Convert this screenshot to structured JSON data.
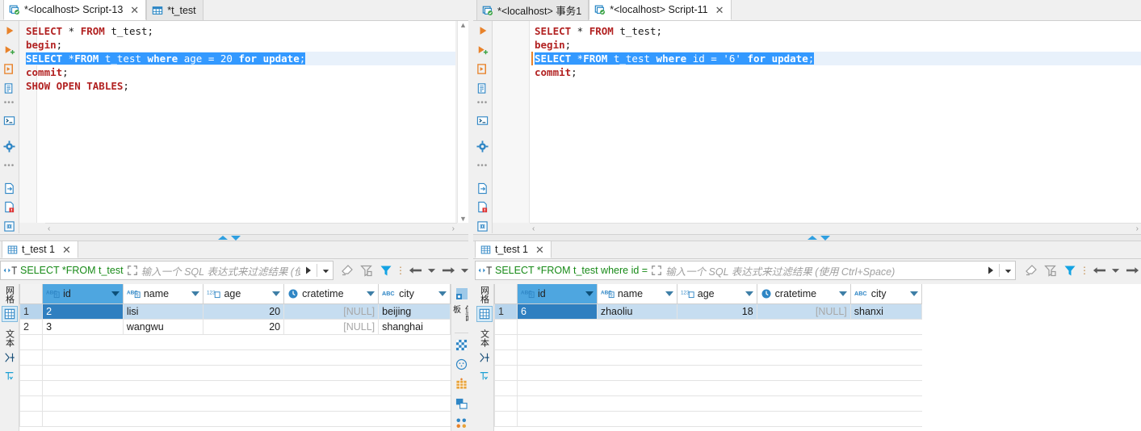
{
  "left_panel": {
    "editor_tabs": [
      {
        "label": "*<localhost> Script-13",
        "icon": "script-console-icon",
        "active": true,
        "closable": true
      },
      {
        "label": "*t_test",
        "icon": "table-icon",
        "active": false,
        "closable": false
      }
    ],
    "code_lines": [
      {
        "segments": [
          {
            "t": "SELECT",
            "k": "kw"
          },
          {
            "t": " * ",
            "k": ""
          },
          {
            "t": "FROM",
            "k": "kw"
          },
          {
            "t": " t_test;",
            "k": ""
          }
        ],
        "state": "normal"
      },
      {
        "segments": [
          {
            "t": "begin",
            "k": "kw"
          },
          {
            "t": ";",
            "k": ""
          }
        ],
        "state": "normal"
      },
      {
        "segments": [
          {
            "t": "SELECT",
            "k": "kw"
          },
          {
            "t": " *",
            "k": ""
          },
          {
            "t": "FROM",
            "k": "kw"
          },
          {
            "t": " t_test ",
            "k": ""
          },
          {
            "t": "where",
            "k": "kw"
          },
          {
            "t": " age = 20 ",
            "k": ""
          },
          {
            "t": "for",
            "k": "kw"
          },
          {
            "t": " ",
            "k": ""
          },
          {
            "t": "update",
            "k": "kw"
          },
          {
            "t": ";",
            "k": ""
          }
        ],
        "state": "selected"
      },
      {
        "segments": [
          {
            "t": "commit",
            "k": "kw"
          },
          {
            "t": ";",
            "k": ""
          }
        ],
        "state": "normal"
      },
      {
        "segments": [
          {
            "t": "",
            "k": ""
          }
        ],
        "state": "normal"
      },
      {
        "segments": [
          {
            "t": "SHOW OPEN TABLES",
            "k": "kw"
          },
          {
            "t": ";",
            "k": ""
          }
        ],
        "state": "normal"
      }
    ],
    "rail_icons": [
      "execute-statement-icon",
      "execute-new-tab-icon",
      "execute-script-icon",
      "explain-plan-icon",
      "more-1-dots",
      "sql-terminal-icon",
      "settings-gear-icon",
      "more-2-dots",
      "export-data-icon",
      "error-log-icon",
      "binary-icon"
    ],
    "result": {
      "tab": {
        "label": "t_test 1",
        "icon": "grid-icon",
        "closable": true
      },
      "filter": {
        "query": "SELECT *FROM t_test",
        "expand_icon": "expand-icon",
        "placeholder": "输入一个 SQL 表达式来过滤结果 (使用 Ctrl+Space)",
        "apply_icon": "apply-filter-icon",
        "history_icon": "dropdown-icon"
      },
      "toolbar": [
        "clear-filter-icon",
        "remove-filter-icon",
        "filter-active-icon",
        "toolbar-overflow-icon",
        "prev-page-icon",
        "prev-page-menu-icon",
        "next-page-icon",
        "next-page-menu-icon"
      ],
      "view_tabs": {
        "grid_label": "网格",
        "text_label": "文本",
        "grid_icon": "grid-view-icon",
        "calc_icon": "calc-icon",
        "filter-panel-icon": "panel-icon"
      },
      "columns": [
        {
          "name": "id",
          "type_icon": "ABC-key-icon",
          "selected": true
        },
        {
          "name": "name",
          "type_icon": "ABC-key-icon",
          "selected": false
        },
        {
          "name": "age",
          "type_icon": "123-number-icon",
          "selected": false
        },
        {
          "name": "cratetime",
          "type_icon": "clock-icon",
          "selected": false
        },
        {
          "name": "city",
          "type_icon": "ABC-icon",
          "selected": false
        }
      ],
      "rows": [
        {
          "num": "1",
          "selected": true,
          "cells": [
            {
              "v": "2",
              "sel": true,
              "align": "left"
            },
            {
              "v": "lisi",
              "sel": false,
              "align": "left"
            },
            {
              "v": "20",
              "sel": false,
              "align": "right"
            },
            {
              "v": "[NULL]",
              "sel": false,
              "align": "right",
              "null": true
            },
            {
              "v": "beijing",
              "sel": false,
              "align": "left"
            }
          ]
        },
        {
          "num": "2",
          "selected": false,
          "cells": [
            {
              "v": "3",
              "sel": false,
              "align": "left"
            },
            {
              "v": "wangwu",
              "sel": false,
              "align": "left"
            },
            {
              "v": "20",
              "sel": false,
              "align": "right"
            },
            {
              "v": "[NULL]",
              "sel": false,
              "align": "right",
              "null": true
            },
            {
              "v": "shanghai",
              "sel": false,
              "align": "left"
            }
          ]
        }
      ],
      "right_rail": [
        "value-panel-icon",
        "panel-label",
        "grid-config-icon",
        "record-icon",
        "add-row-icon",
        "maximize-panel-icon",
        "transpose-icon"
      ],
      "right_rail_label": "值面板"
    }
  },
  "right_panel": {
    "editor_tabs": [
      {
        "label": "*<localhost> 事务1",
        "icon": "script-console-icon",
        "active": false,
        "closable": false
      },
      {
        "label": "*<localhost> Script-11",
        "icon": "script-console-icon",
        "active": true,
        "closable": true
      }
    ],
    "code_lines": [
      {
        "segments": [
          {
            "t": "SELECT",
            "k": "kw"
          },
          {
            "t": " * ",
            "k": ""
          },
          {
            "t": "FROM",
            "k": "kw"
          },
          {
            "t": " t_test;",
            "k": ""
          }
        ],
        "state": "normal"
      },
      {
        "segments": [
          {
            "t": "begin",
            "k": "kw"
          },
          {
            "t": ";",
            "k": ""
          }
        ],
        "state": "normal"
      },
      {
        "segments": [
          {
            "t": "SELECT",
            "k": "kw"
          },
          {
            "t": " *",
            "k": ""
          },
          {
            "t": "FROM",
            "k": "kw"
          },
          {
            "t": " t_test ",
            "k": ""
          },
          {
            "t": "where",
            "k": "kw"
          },
          {
            "t": " id = '6' ",
            "k": ""
          },
          {
            "t": "for",
            "k": "kw"
          },
          {
            "t": " ",
            "k": ""
          },
          {
            "t": "update",
            "k": "kw"
          },
          {
            "t": ";",
            "k": ""
          }
        ],
        "state": "selected"
      },
      {
        "segments": [
          {
            "t": "commit",
            "k": "kw"
          },
          {
            "t": ";",
            "k": ""
          }
        ],
        "state": "normal"
      }
    ],
    "rail_icons": [
      "execute-statement-icon",
      "execute-new-tab-icon",
      "execute-script-icon",
      "explain-plan-icon",
      "more-1-dots",
      "sql-terminal-icon",
      "settings-gear-icon",
      "more-2-dots",
      "export-data-icon",
      "error-log-icon",
      "binary-icon"
    ],
    "result": {
      "tab": {
        "label": "t_test 1",
        "icon": "grid-icon",
        "closable": true
      },
      "filter": {
        "query": "SELECT *FROM t_test where id =",
        "expand_icon": "expand-icon",
        "placeholder": "输入一个 SQL 表达式来过滤结果 (使用 Ctrl+Space)",
        "apply_icon": "apply-filter-icon",
        "history_icon": "dropdown-icon"
      },
      "toolbar": [
        "clear-filter-icon",
        "remove-filter-icon",
        "filter-active-icon",
        "toolbar-overflow-icon",
        "prev-page-icon",
        "prev-page-menu-icon",
        "next-page-icon"
      ],
      "view_tabs": {
        "grid_label": "网格",
        "text_label": "文本",
        "grid_icon": "grid-view-icon"
      },
      "columns": [
        {
          "name": "id",
          "type_icon": "ABC-key-icon",
          "selected": true
        },
        {
          "name": "name",
          "type_icon": "ABC-key-icon",
          "selected": false
        },
        {
          "name": "age",
          "type_icon": "123-number-icon",
          "selected": false
        },
        {
          "name": "cratetime",
          "type_icon": "clock-icon",
          "selected": false
        },
        {
          "name": "city",
          "type_icon": "ABC-icon",
          "selected": false
        }
      ],
      "rows": [
        {
          "num": "1",
          "selected": true,
          "cells": [
            {
              "v": "6",
              "sel": true,
              "align": "left"
            },
            {
              "v": "zhaoliu",
              "sel": false,
              "align": "left"
            },
            {
              "v": "18",
              "sel": false,
              "align": "right"
            },
            {
              "v": "[NULL]",
              "sel": false,
              "align": "right",
              "null": true
            },
            {
              "v": "shanxi",
              "sel": false,
              "align": "left"
            }
          ]
        }
      ]
    }
  },
  "colors": {
    "accent_blue": "#2f9fe0",
    "selection_blue": "#3399ff",
    "header_selected": "#4ea6e0",
    "keyword_red": "#b22222",
    "query_green": "#178a17",
    "cell_selected": "#2f7fc0",
    "row_selected": "#c6ddf0"
  }
}
